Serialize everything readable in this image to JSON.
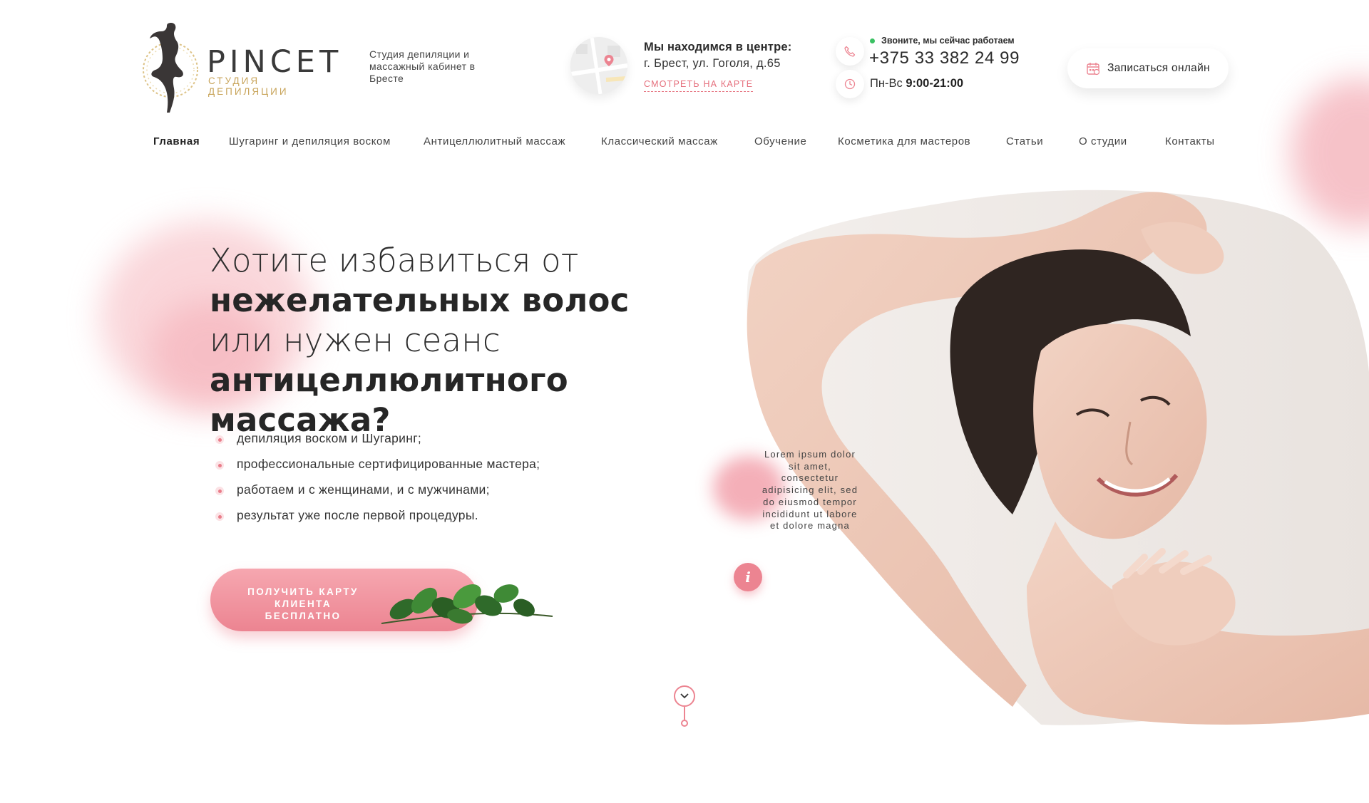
{
  "header": {
    "logo_name": "PINCET",
    "logo_sub": "СТУДИЯ ДЕПИЛЯЦИИ",
    "studio_desc": "Студия депиляции и массажный кабинет в Бресте",
    "location_title": "Мы находимся в центре:",
    "location_address": "г. Брест, ул. Гоголя, д.65",
    "map_link": "СМОТРЕТЬ НА КАРТЕ",
    "call_note": "Звоните, мы сейчас работаем",
    "phone": "+375 33 382 24 99",
    "hours_days": "Пн-Вс",
    "hours_time": "9:00-21:00",
    "book_button": "Записаться онлайн"
  },
  "nav": {
    "items": [
      {
        "label": "Главная",
        "active": true
      },
      {
        "label": "Шугаринг и депиляция воском",
        "active": false
      },
      {
        "label": "Антицеллюлитный массаж",
        "active": false
      },
      {
        "label": "Классический массаж",
        "active": false
      },
      {
        "label": "Обучение",
        "active": false
      },
      {
        "label": "Косметика для мастеров",
        "active": false
      },
      {
        "label": "Статьи",
        "active": false
      },
      {
        "label": "О студии",
        "active": false
      },
      {
        "label": "Контакты",
        "active": false
      }
    ]
  },
  "hero": {
    "line1": "Хотите избавиться от",
    "line2": "нежелательных волос",
    "line3": "или нужен сеанс",
    "line4": "антицеллюлитного массажа?",
    "bullets": [
      "депиляция воском и Шугаринг;",
      "профессиональные сертифицированные мастера;",
      "работаем и с женщинами, и с мужчинами;",
      "результат уже после первой процедуры."
    ],
    "cta_label": "ПОЛУЧИТЬ КАРТУ КЛИЕНТА БЕСПЛАТНО",
    "lorem": "Lorem ipsum dolor sit amet, consectetur adipisicing elit, sed do eiusmod tempor incididunt ut labore et dolore magna",
    "info_glyph": "i"
  },
  "colors": {
    "accent": "#ec8491",
    "accent_light": "#f6a7b0",
    "gold": "#c8a45a",
    "status_green": "#3bc163"
  },
  "icons": [
    "woman-silhouette-logo",
    "map-pin-icon",
    "phone-icon",
    "clock-icon",
    "calendar-icon",
    "info-icon",
    "chevron-down-icon",
    "leaves-decoration"
  ]
}
